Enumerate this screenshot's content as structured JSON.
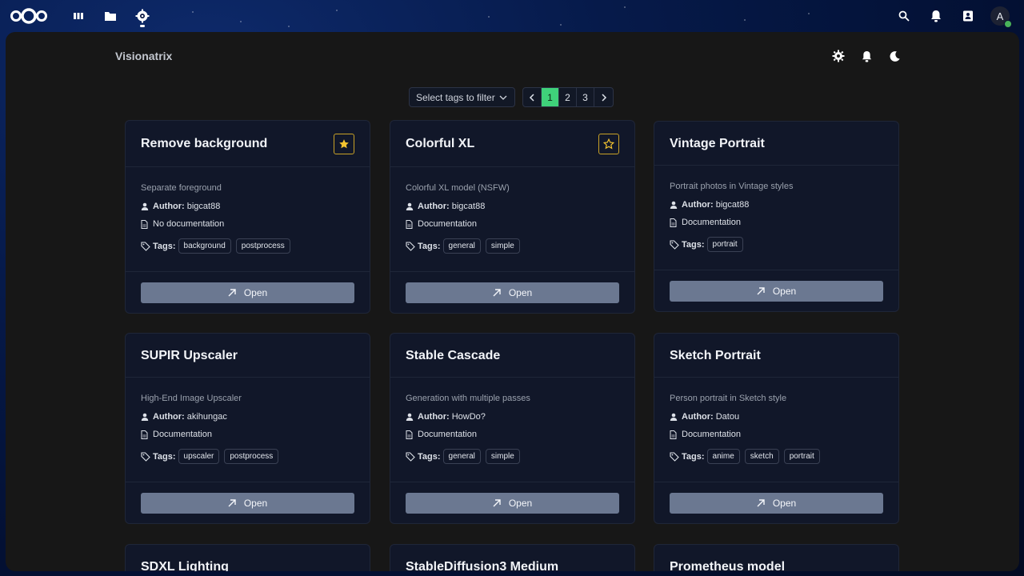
{
  "topbar": {
    "avatar_initial": "A",
    "accent_color": "#3fd27a"
  },
  "header": {
    "app_title": "Visionatrix"
  },
  "filter": {
    "tag_select_placeholder": "Select tags to filter"
  },
  "pagination": {
    "pages": [
      "1",
      "2",
      "3"
    ],
    "current": "1"
  },
  "labels": {
    "author": "Author:",
    "tags": "Tags:",
    "open": "Open"
  },
  "cards": [
    {
      "title": "Remove background",
      "starred": true,
      "description": "Separate foreground",
      "author": "bigcat88",
      "documentation": "No documentation",
      "tags": [
        "background",
        "postprocess"
      ]
    },
    {
      "title": "Colorful XL",
      "starred": false,
      "show_star": true,
      "description": "Colorful XL model (NSFW)",
      "author": "bigcat88",
      "documentation": "Documentation",
      "tags": [
        "general",
        "simple"
      ]
    },
    {
      "title": "Vintage Portrait",
      "description": "Portrait photos in Vintage styles",
      "author": "bigcat88",
      "documentation": "Documentation",
      "tags": [
        "portrait"
      ]
    },
    {
      "title": "SUPIR Upscaler",
      "description": "High-End Image Upscaler",
      "author": "akihungac",
      "documentation": "Documentation",
      "tags": [
        "upscaler",
        "postprocess"
      ]
    },
    {
      "title": "Stable Cascade",
      "description": "Generation with multiple passes",
      "author": "HowDo?",
      "documentation": "Documentation",
      "tags": [
        "general",
        "simple"
      ]
    },
    {
      "title": "Sketch Portrait",
      "description": "Person portrait in Sketch style",
      "author": "Datou",
      "documentation": "Documentation",
      "tags": [
        "anime",
        "sketch",
        "portrait"
      ]
    },
    {
      "title": "SDXL Lighting"
    },
    {
      "title": "StableDiffusion3 Medium"
    },
    {
      "title": "Prometheus model"
    }
  ]
}
